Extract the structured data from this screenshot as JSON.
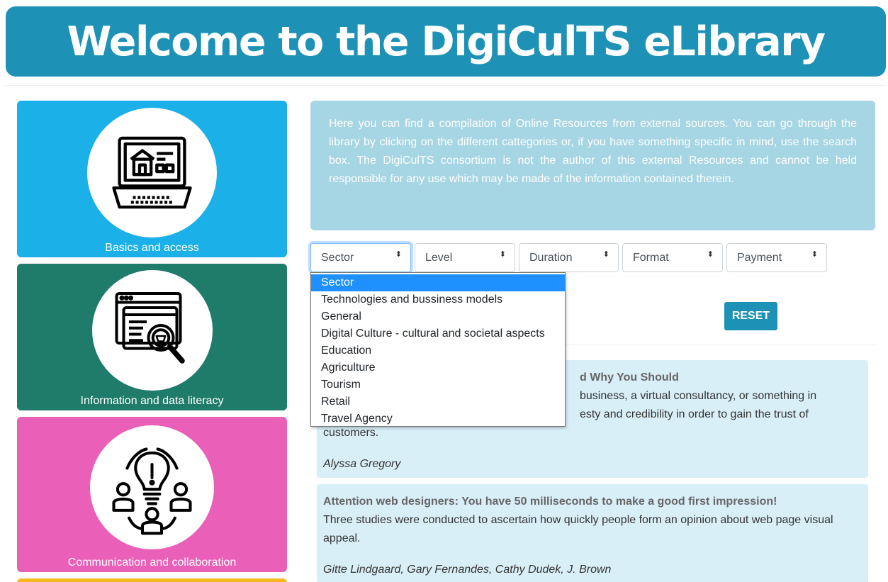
{
  "banner": {
    "title": "Welcome to the DigiCulTS eLibrary"
  },
  "categories": [
    {
      "label": "Basics and access",
      "icon": "laptop-house-icon",
      "color": "#1bb0e8"
    },
    {
      "label": "Information and data literacy",
      "icon": "browser-search-icon",
      "color": "#1f7b6a"
    },
    {
      "label": "Communication and collaboration",
      "icon": "lightbulb-people-icon",
      "color": "#ea5fb7"
    },
    {
      "label": "",
      "icon": "",
      "color": "#f6b91f"
    }
  ],
  "intro": {
    "text": "Here you can find a compilation of Online Resources from external sources. You can go through the library by clicking on the different cattegories or, if you have something specific in mind, use the search box. The DigiCulTS consortium is not the author of this external Resources and cannot be held responsible for any use which may be made of the information contained therein."
  },
  "filters": [
    {
      "label": "Sector",
      "caret": "⬍"
    },
    {
      "label": "Level",
      "caret": "⬍"
    },
    {
      "label": "Duration",
      "caret": "⬍"
    },
    {
      "label": "Format",
      "caret": "⬍"
    },
    {
      "label": "Payment",
      "caret": "⬍"
    }
  ],
  "reset_label": "RESET",
  "sector_dropdown": {
    "options": [
      "Sector",
      "Technologies and bussiness models",
      "General",
      "Digital Culture - cultural and societal aspects",
      "Education",
      "Agriculture",
      "Tourism",
      "Retail",
      "Travel Agency"
    ],
    "selected": "Sector"
  },
  "resources": [
    {
      "title": "d Why You Should",
      "desc": "business, a virtual consultancy, or something in",
      "desc_2": "esty and credibility in order to gain the trust of",
      "desc_3": "customers.",
      "author": "Alyssa Gregory"
    },
    {
      "title": "Attention web designers: You have 50 milliseconds to make a good first impression!",
      "desc": "Three studies were conducted to ascertain how quickly people form an opinion about web page visual appeal.",
      "author": "Gitte Lindgaard, Gary Fernandes, Cathy Dudek, J. Brown"
    }
  ],
  "colors": {
    "brand": "#1d92b6",
    "intro_bg": "#a6d5e3",
    "card_bg": "#d9eff8",
    "dropdown_highlight": "#1e90ff"
  }
}
